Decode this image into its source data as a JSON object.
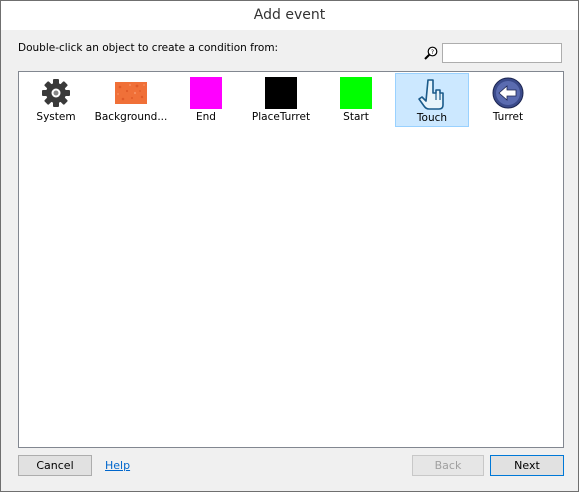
{
  "dialog": {
    "title": "Add event",
    "instruction": "Double-click an object to create a condition from:"
  },
  "search": {
    "placeholder": "",
    "value": ""
  },
  "objects": [
    {
      "label": "System",
      "icon": "gear-icon"
    },
    {
      "label": "Background...",
      "icon": "orange-texture-icon",
      "color": "#f07038"
    },
    {
      "label": "End",
      "icon": "magenta-square-icon",
      "color": "#ff00ff"
    },
    {
      "label": "PlaceTurret",
      "icon": "black-square-icon",
      "color": "#000000"
    },
    {
      "label": "Start",
      "icon": "green-square-icon",
      "color": "#00ff00"
    },
    {
      "label": "Touch",
      "icon": "touch-hand-icon",
      "selected": true
    },
    {
      "label": "Turret",
      "icon": "back-arrow-circle-icon",
      "color": "#3a4a8a"
    }
  ],
  "buttons": {
    "cancel": "Cancel",
    "help": "Help",
    "back": "Back",
    "next": "Next"
  }
}
